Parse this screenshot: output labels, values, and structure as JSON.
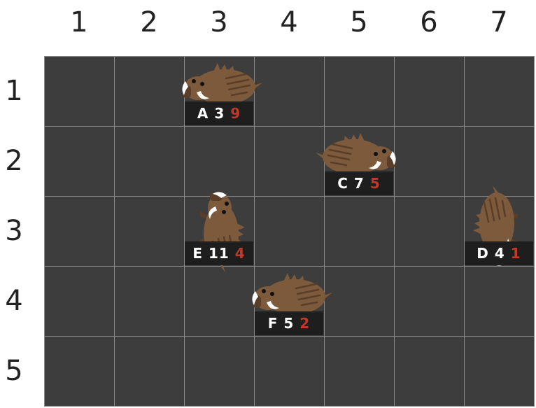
{
  "columns": [
    "1",
    "2",
    "3",
    "4",
    "5",
    "6",
    "7"
  ],
  "rows": [
    "1",
    "2",
    "3",
    "4",
    "5"
  ],
  "colors": {
    "board": "#3d3d3d",
    "grid": "#8a8a8a",
    "boar_body": "#7d5a3c",
    "boar_dark": "#5a3e28",
    "tusk": "#ffffff",
    "label_bg": "#1e1e1e",
    "label_text": "#ffffff",
    "label_highlight": "#c0392b"
  },
  "pieces": [
    {
      "id": "A",
      "col": 3,
      "row": 1,
      "v1": "3",
      "v2": "9",
      "facing": "left"
    },
    {
      "id": "C",
      "col": 5,
      "row": 2,
      "v1": "7",
      "v2": "5",
      "facing": "right"
    },
    {
      "id": "E",
      "col": 3,
      "row": 3,
      "v1": "11",
      "v2": "4",
      "facing": "up"
    },
    {
      "id": "D",
      "col": 7,
      "row": 3,
      "v1": "4",
      "v2": "1",
      "facing": "down"
    },
    {
      "id": "F",
      "col": 4,
      "row": 4,
      "v1": "5",
      "v2": "2",
      "facing": "left"
    }
  ]
}
